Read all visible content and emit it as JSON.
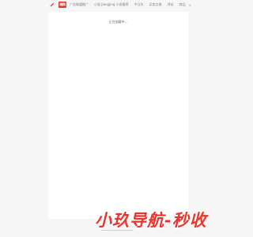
{
  "header": {
    "logo_text": "嗨购",
    "nav": [
      "广告联盟推广",
      "小说 Jiangjing 小说推荐",
      "今日头",
      "买卖交易",
      "评论",
      "商品"
    ],
    "close_symbol": "×"
  },
  "main": {
    "loading_text": "正在加载中..."
  },
  "watermark": {
    "text": "小玖导航-秒收"
  },
  "colors": {
    "brand_red": "#e23b35",
    "watermark_red": "#e9352c"
  },
  "icons": [
    "bird-icon"
  ]
}
